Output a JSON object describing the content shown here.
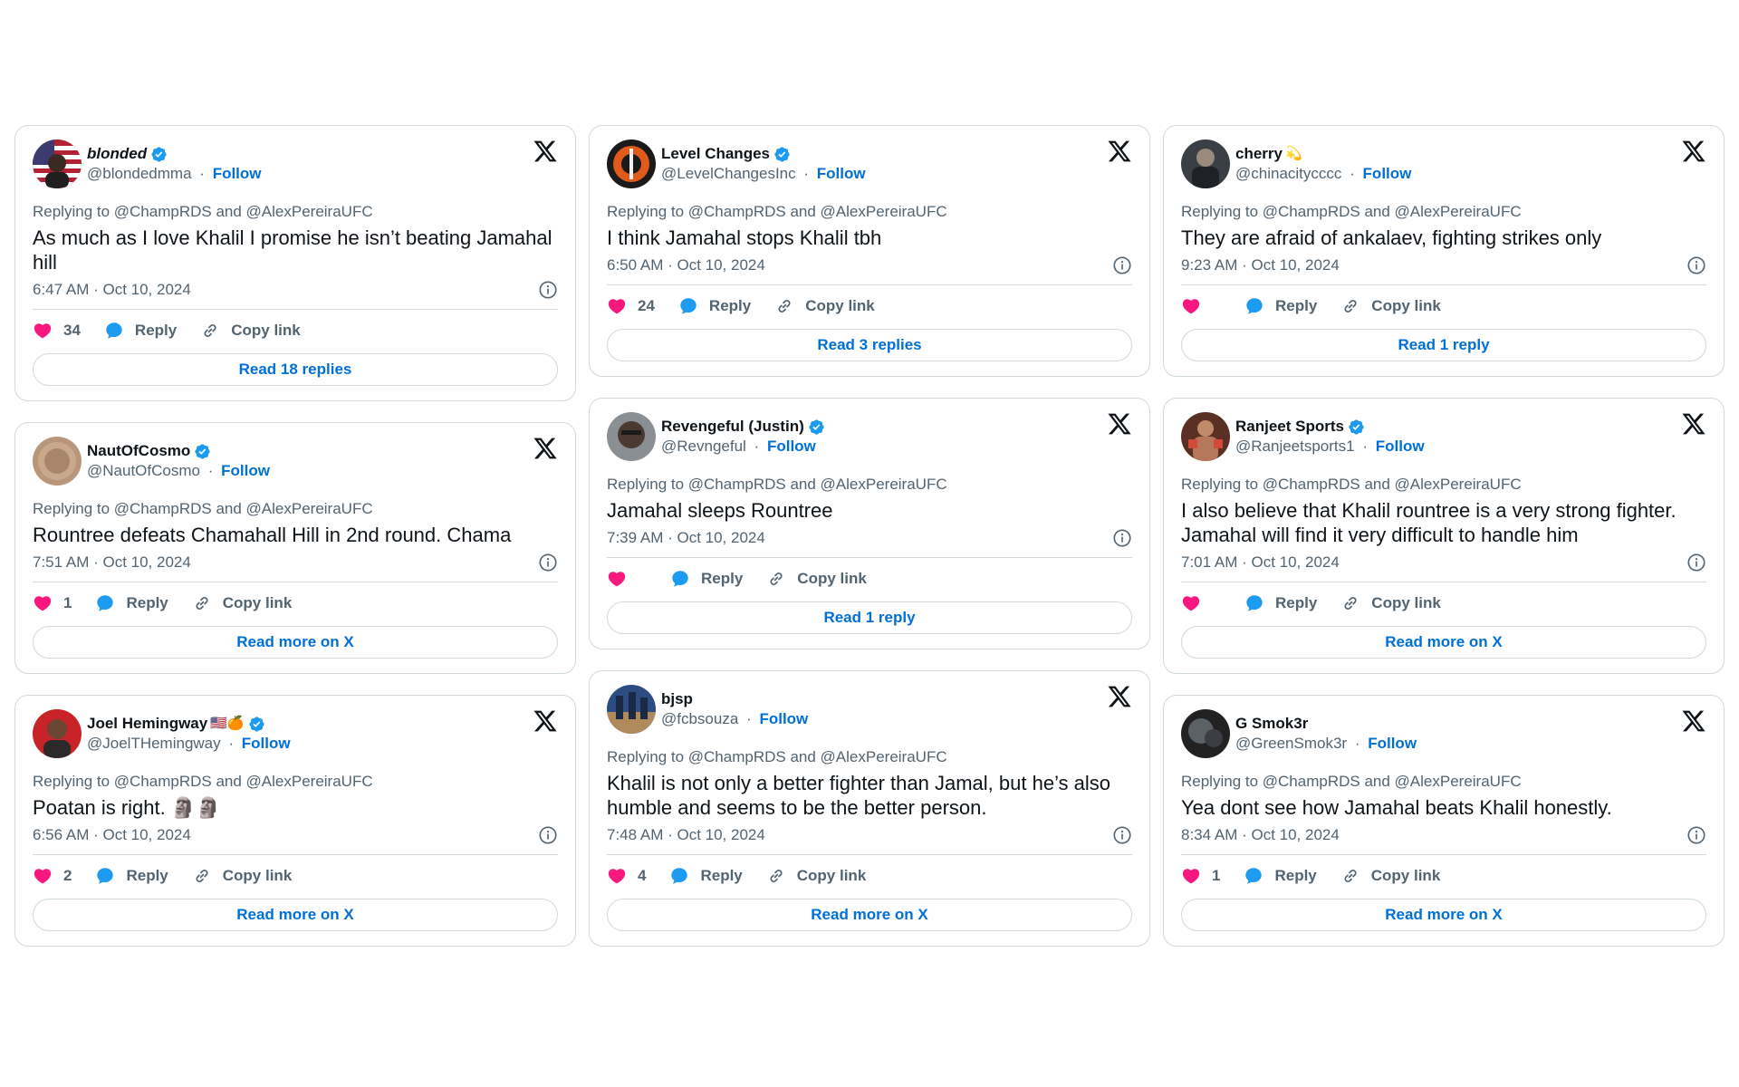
{
  "colors": {
    "accent": "#006fd6",
    "like": "#f91880",
    "verified": "#1d9bf0",
    "border": "#cfd9de",
    "muted": "#536471"
  },
  "labels": {
    "reply": "Reply",
    "copy_link": "Copy link",
    "follow": "Follow",
    "dot": "·"
  },
  "columns": [
    [
      {
        "name": "blonded",
        "italic": true,
        "verified": true,
        "emoji": "",
        "handle": "@blondedmma",
        "replying": "Replying to @ChampRDS and @AlexPereiraUFC",
        "text": "As much as I love Khalil I promise he isn’t beating Jamahal hill",
        "time": "6:47 AM · Oct 10, 2024",
        "likes": "34",
        "button": "Read 18 replies",
        "avatar": "flag"
      },
      {
        "name": "NautOfCosmo",
        "italic": false,
        "verified": true,
        "emoji": "",
        "handle": "@NautOfCosmo",
        "replying": "Replying to @ChampRDS and @AlexPereiraUFC",
        "text": "Rountree defeats Chamahall Hill in 2nd round. Chama",
        "time": "7:51 AM · Oct 10, 2024",
        "likes": "1",
        "button": "Read more on X",
        "avatar": "tan"
      },
      {
        "name": "Joel Hemingway",
        "italic": false,
        "verified": true,
        "emoji": "🇺🇸🍊",
        "handle": "@JoelTHemingway",
        "replying": "Replying to @ChampRDS and @AlexPereiraUFC",
        "text": "Poatan is right. 🗿🗿",
        "time": "6:56 AM · Oct 10, 2024",
        "likes": "2",
        "button": "Read more on X",
        "avatar": "red"
      }
    ],
    [
      {
        "name": "Level Changes",
        "italic": false,
        "verified": true,
        "emoji": "",
        "handle": "@LevelChangesInc",
        "replying": "Replying to @ChampRDS and @AlexPereiraUFC",
        "text": "I think Jamahal stops Khalil tbh",
        "time": "6:50 AM · Oct 10, 2024",
        "likes": "24",
        "button": "Read 3 replies",
        "avatar": "orange"
      },
      {
        "name": "Revengeful (Justin)",
        "italic": false,
        "verified": true,
        "emoji": "",
        "handle": "@Revngeful",
        "replying": "Replying to @ChampRDS and @AlexPereiraUFC",
        "text": "Jamahal sleeps Rountree",
        "time": "7:39 AM · Oct 10, 2024",
        "likes": "",
        "button": "Read 1 reply",
        "avatar": "gray"
      },
      {
        "name": "bjsp",
        "italic": false,
        "verified": false,
        "emoji": "",
        "handle": "@fcbsouza",
        "replying": "Replying to @ChampRDS and @AlexPereiraUFC",
        "text": "Khalil is not only a better fighter than Jamal, but he’s also humble and seems to be the better person.",
        "time": "7:48 AM · Oct 10, 2024",
        "likes": "4",
        "button": "Read more on X",
        "avatar": "blue"
      }
    ],
    [
      {
        "name": "cherry",
        "italic": false,
        "verified": false,
        "emoji": "💫",
        "handle": "@chinacitycccc",
        "replying": "Replying to @ChampRDS and @AlexPereiraUFC",
        "text": "They are afraid of ankalaev, fighting strikes only",
        "time": "9:23 AM · Oct 10, 2024",
        "likes": "",
        "button": "Read 1 reply",
        "avatar": "dark"
      },
      {
        "name": "Ranjeet Sports",
        "italic": false,
        "verified": true,
        "emoji": "",
        "handle": "@Ranjeetsports1",
        "replying": "Replying to @ChampRDS and @AlexPereiraUFC",
        "text": "I also believe that Khalil rountree is a very strong fighter. Jamahal  will find it very difficult to handle him",
        "time": "7:01 AM · Oct 10, 2024",
        "likes": "",
        "button": "Read more on X",
        "avatar": "brown"
      },
      {
        "name": "G Smok3r",
        "italic": false,
        "verified": false,
        "emoji": "",
        "handle": "@GreenSmok3r",
        "replying": "Replying to @ChampRDS and @AlexPereiraUFC",
        "text": "Yea dont see how Jamahal beats Khalil honestly.",
        "time": "8:34 AM · Oct 10, 2024",
        "likes": "1",
        "button": "Read more on X",
        "avatar": "black"
      }
    ]
  ]
}
